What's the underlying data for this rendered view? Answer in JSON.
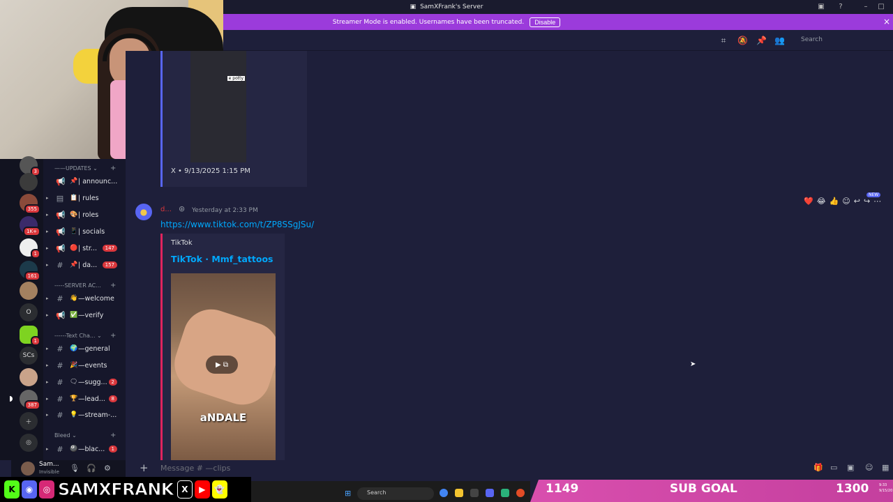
{
  "window": {
    "title": "SamXFrank's Server"
  },
  "banner": {
    "text": "Streamer Mode is enabled. Usernames have been truncated.",
    "button": "Disable"
  },
  "toolbar": {
    "search_placeholder": "Search"
  },
  "servers": [
    {
      "badge": "3"
    },
    {
      "badge": ""
    },
    {
      "badge": "355"
    },
    {
      "badge": "1K+"
    },
    {
      "badge": "1"
    },
    {
      "badge": "161"
    },
    {
      "badge": ""
    },
    {
      "label": "O"
    },
    {
      "badge": "1"
    },
    {
      "label": "SCs"
    },
    {
      "badge": ""
    },
    {
      "badge": "387"
    }
  ],
  "channels": {
    "categories": [
      "UPDATES",
      "SERVER AC...",
      "Text Cha...",
      "Bleed"
    ],
    "items": [
      {
        "name": "| announc...",
        "emoji": "📌"
      },
      {
        "name": "| rules",
        "emoji": "📋"
      },
      {
        "name": "| roles",
        "emoji": "🎨"
      },
      {
        "name": "| socials",
        "emoji": "📱"
      },
      {
        "name": "| str...",
        "emoji": "🔴",
        "count": "147"
      },
      {
        "name": "| da...",
        "emoji": "📌",
        "count": "157"
      },
      {
        "name": "—welcome",
        "emoji": "👋"
      },
      {
        "name": "—verify",
        "emoji": "✅"
      },
      {
        "name": "—general",
        "emoji": "🌍"
      },
      {
        "name": "—events",
        "emoji": "🎉"
      },
      {
        "name": "—sugg...",
        "emoji": "🗨",
        "count": "2"
      },
      {
        "name": "—lead...",
        "emoji": "🏆",
        "count": "8"
      },
      {
        "name": "—stream-...",
        "emoji": "💡"
      },
      {
        "name": "—blac...",
        "emoji": "🎱",
        "count": "1"
      }
    ]
  },
  "user": {
    "name": "Sam...",
    "status": "Invisible"
  },
  "messages": {
    "embed_top_source": "X • 9/13/2025 1:15 PM",
    "embed_top_img_tag": "e potty",
    "author": "d...",
    "time": "Yesterday at 2:33 PM",
    "link": "https://www.tiktok.com/t/ZP8SSgJSu/",
    "embed_provider": "TikTok",
    "embed_title": "TikTok · Mmf_tattoos",
    "video_caption": "aNDALE",
    "new_tag": "NEW"
  },
  "composer": {
    "placeholder": "Message # —clips"
  },
  "overlay": {
    "handle": "SAMXFRANK"
  },
  "taskbar": {
    "search": "Search"
  },
  "subgoal": {
    "current": "1149",
    "label": "SUB GOAL",
    "target": "1300",
    "clock": "9:33\n9/15/20"
  },
  "colors": {
    "accent": "#5865f2",
    "banner": "#9b3bdb",
    "mention": "#da373c",
    "link": "#00a8fc",
    "goal": "#d94fae"
  }
}
